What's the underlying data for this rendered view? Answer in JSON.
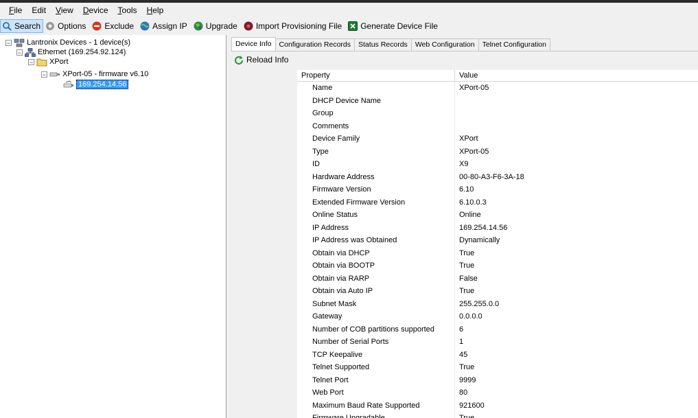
{
  "menu": [
    {
      "accel": "F",
      "rest": "ile"
    },
    {
      "accel": "",
      "rest": "Edit"
    },
    {
      "accel": "V",
      "rest": "iew"
    },
    {
      "accel": "D",
      "rest": "evice"
    },
    {
      "accel": "T",
      "rest": "ools"
    },
    {
      "accel": "H",
      "rest": "elp"
    }
  ],
  "toolbar": {
    "search": "Search",
    "options": "Options",
    "exclude": "Exclude",
    "assign_ip": "Assign IP",
    "upgrade": "Upgrade",
    "import": "Import Provisioning File",
    "generate": "Generate Device File"
  },
  "tree": {
    "root": "Lantronix Devices - 1 device(s)",
    "ethernet": "Ethernet (169.254.92.124)",
    "folder": "XPort",
    "device": "XPort-05 - firmware v6.10",
    "ip": "169.254.14.56"
  },
  "tabs": [
    "Device Info",
    "Configuration Records",
    "Status Records",
    "Web Configuration",
    "Telnet Configuration"
  ],
  "reload_label": "Reload Info",
  "grid": {
    "headers": {
      "property": "Property",
      "value": "Value"
    },
    "rows": [
      {
        "p": "Name",
        "v": "XPort-05"
      },
      {
        "p": "DHCP Device Name",
        "v": ""
      },
      {
        "p": "Group",
        "v": ""
      },
      {
        "p": "Comments",
        "v": ""
      },
      {
        "p": "Device Family",
        "v": "XPort"
      },
      {
        "p": "Type",
        "v": "XPort-05"
      },
      {
        "p": "ID",
        "v": "X9"
      },
      {
        "p": "Hardware Address",
        "v": "00-80-A3-F6-3A-18"
      },
      {
        "p": "Firmware Version",
        "v": "6.10"
      },
      {
        "p": "Extended Firmware Version",
        "v": "6.10.0.3"
      },
      {
        "p": "Online Status",
        "v": "Online"
      },
      {
        "p": "IP Address",
        "v": "169.254.14.56"
      },
      {
        "p": "IP Address was Obtained",
        "v": "Dynamically"
      },
      {
        "p": "Obtain via DHCP",
        "v": "True"
      },
      {
        "p": "Obtain via BOOTP",
        "v": "True"
      },
      {
        "p": "Obtain via RARP",
        "v": "False"
      },
      {
        "p": "Obtain via Auto IP",
        "v": "True"
      },
      {
        "p": "Subnet Mask",
        "v": "255.255.0.0"
      },
      {
        "p": "Gateway",
        "v": "0.0.0.0"
      },
      {
        "p": "Number of COB partitions supported",
        "v": "6"
      },
      {
        "p": "Number of Serial Ports",
        "v": "1"
      },
      {
        "p": "TCP Keepalive",
        "v": "45"
      },
      {
        "p": "Telnet Supported",
        "v": "True"
      },
      {
        "p": "Telnet Port",
        "v": "9999"
      },
      {
        "p": "Web Port",
        "v": "80"
      },
      {
        "p": "Maximum Baud Rate Supported",
        "v": "921600"
      },
      {
        "p": "Firmware Upgradable",
        "v": "True"
      }
    ]
  }
}
